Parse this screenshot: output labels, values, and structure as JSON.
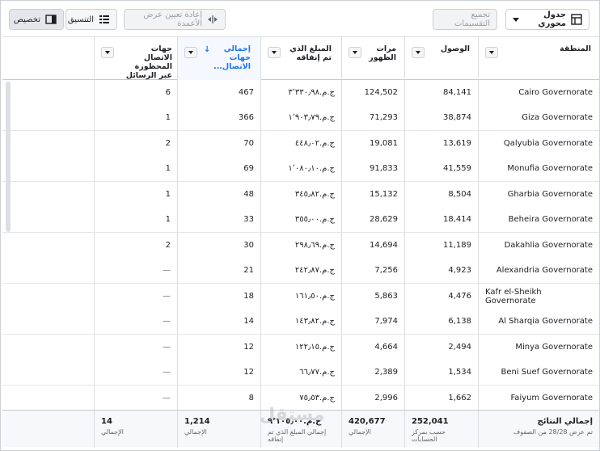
{
  "toolbar": {
    "pivot_label": "جدول محوري",
    "group_label": "تجميع التقسيمات",
    "reset_label": "إعادة تعيين عرض الأعمدة",
    "format_label": "التنسيق",
    "customize_label": "تخصيص"
  },
  "columns": {
    "region": "المنطقة",
    "reach": "الوصول",
    "impressions": "مرات الظهور",
    "spent": "المبلغ الذي تم إنفاقه",
    "contacts": "إجمالي جهات الاتصال...",
    "blocked": "جهات الاتصال المحظورة عبر الرسائل"
  },
  "rows": [
    {
      "region": "Cairo Governorate",
      "reach": "84,141",
      "impressions": "124,502",
      "spent": "ج.م.‏٣٬٣٣٠٫٩٨",
      "contacts": "467",
      "blocked": "6"
    },
    {
      "region": "Giza Governorate",
      "reach": "38,874",
      "impressions": "71,293",
      "spent": "ج.م.‏١٬٩٠٣٫٧٩",
      "contacts": "366",
      "blocked": "1"
    },
    {
      "region": "Qalyubia Governorate",
      "reach": "13,619",
      "impressions": "19,081",
      "spent": "ج.م.‏٤٤٨٫٠٢",
      "contacts": "70",
      "blocked": "2"
    },
    {
      "region": "Monufia Governorate",
      "reach": "41,559",
      "impressions": "91,833",
      "spent": "ج.م.‏١٬٠٨٠٫١٠",
      "contacts": "69",
      "blocked": "1"
    },
    {
      "region": "Gharbia Governorate",
      "reach": "8,504",
      "impressions": "15,132",
      "spent": "ج.م.‏٣٤٥٫٨٢",
      "contacts": "48",
      "blocked": "1"
    },
    {
      "region": "Beheira Governorate",
      "reach": "18,414",
      "impressions": "28,629",
      "spent": "ج.م.‏٣٥٥٫٠٠",
      "contacts": "33",
      "blocked": "1"
    },
    {
      "region": "Dakahlia Governorate",
      "reach": "11,189",
      "impressions": "14,694",
      "spent": "ج.م.‏٢٩٨٫٦٩",
      "contacts": "30",
      "blocked": "2"
    },
    {
      "region": "Alexandria Governorate",
      "reach": "4,923",
      "impressions": "7,256",
      "spent": "ج.م.‏٢٤٢٫٨٧",
      "contacts": "21",
      "blocked": "—"
    },
    {
      "region": "Kafr el-Sheikh Governorate",
      "reach": "4,476",
      "impressions": "5,863",
      "spent": "ج.م.‏١٦١٫٥٠",
      "contacts": "18",
      "blocked": "—"
    },
    {
      "region": "Al Sharqia Governorate",
      "reach": "6,138",
      "impressions": "7,974",
      "spent": "ج.م.‏١٤٣٫٨٢",
      "contacts": "14",
      "blocked": "—"
    },
    {
      "region": "Minya Governorate",
      "reach": "2,494",
      "impressions": "4,664",
      "spent": "ج.م.‏١٢٢٫١٥",
      "contacts": "12",
      "blocked": "—"
    },
    {
      "region": "Beni Suef Governorate",
      "reach": "1,534",
      "impressions": "2,389",
      "spent": "ج.م.‏٦٦٫٧٧",
      "contacts": "12",
      "blocked": "—"
    },
    {
      "region": "Faiyum Governorate",
      "reach": "1,662",
      "impressions": "2,996",
      "spent": "ج.م.‏٧٥٫٥٣",
      "contacts": "8",
      "blocked": "—"
    }
  ],
  "footer": {
    "region_value": "إجمالي النتائج",
    "region_label": "تم عرض 28/28 من الصفوف",
    "reach_value": "252,041",
    "reach_label": "حسب بمركز الحسابات",
    "impressions_value": "420,677",
    "impressions_label": "الإجمالي",
    "spent_value": "ج.م.‏٩٬١٠٥٫٠٠",
    "spent_label": "إجمالي المبلغ الذي تم إنفاقه",
    "contacts_value": "1,214",
    "contacts_label": "الإجمالي",
    "blocked_value": "14",
    "blocked_label": "الإجمالي"
  },
  "watermark": "مستقل",
  "colors": {
    "accent": "#1877f2",
    "border": "#dadde1"
  }
}
